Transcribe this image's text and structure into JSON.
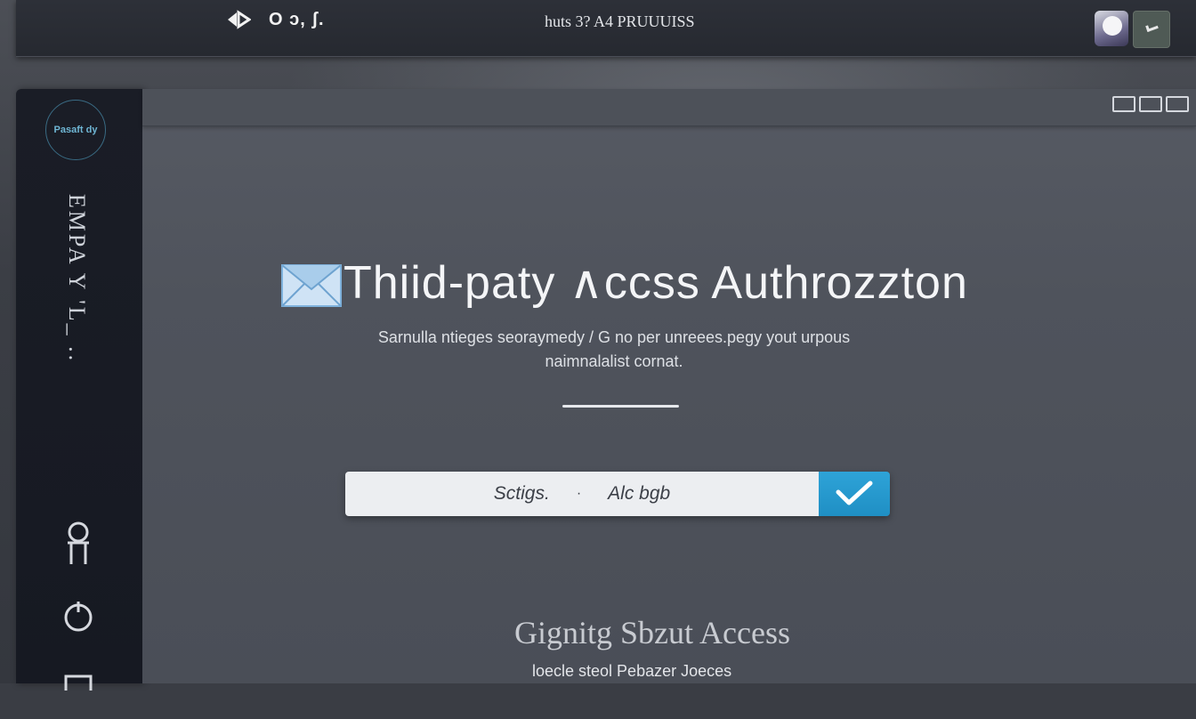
{
  "top_bar": {
    "nav_text": "O ɔ, ʃ.",
    "title": "huts 3? A4 PRUUUISS",
    "icons": [
      "back-forward-icon",
      "user-avatar",
      "status-square-icon"
    ]
  },
  "sidebar": {
    "logo_text": "Pasaft dy",
    "vertical_label": "EMPA Y 'L_ ..",
    "icons": [
      "person-icon",
      "power-icon",
      "document-icon"
    ]
  },
  "main": {
    "title": "Thiid-paty ∧ccss Authrozzton",
    "subtitle_line1": "Sarnulla ntieges seoraymedy / G no per unreees.pegy yout urpous",
    "subtitle_line2": "naimnalalist cornat.",
    "search": {
      "left_text": "Sctigs.",
      "separator": "·",
      "right_text": "Alc bgb"
    },
    "confirm_icon": "checkmark-icon",
    "footer_title": "Gignitg Sbzut  Access",
    "footer_subtitle": "loecle steol Pebazer Joeces"
  },
  "colors": {
    "accent": "#2ea3d8",
    "sidebar_bg": "#1a1d26",
    "panel_bg": "#52565f"
  }
}
